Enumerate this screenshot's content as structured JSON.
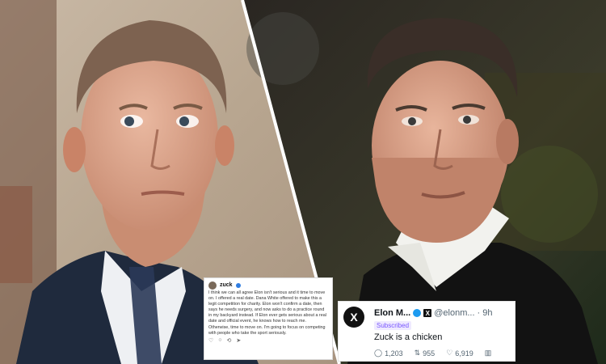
{
  "threads": {
    "username": "zuck",
    "text": "I think we can all agree Elon isn't serious and it time to move on. I offered a real date. Dana White offered to make this a legit competition for charity. Elon won't confirm a date, then says he needs surgery, and now asks to do a practice round in my backyard instead. If Elon ever gets serious about a real date and official event, he knows how to reach me. Otherwise, time to move on. I'm going to focus on competing with people who take the sport seriously.",
    "actions": [
      "♡",
      "○",
      "⟲",
      "➤"
    ]
  },
  "x_post": {
    "avatar_letter": "X",
    "name": "Elon M...",
    "handle": "@elonm...",
    "time": "· 9h",
    "subscribed": "Subscribed",
    "text": "Zuck is a chicken",
    "replies": "1,203",
    "reposts": "955",
    "likes": "6,919"
  }
}
